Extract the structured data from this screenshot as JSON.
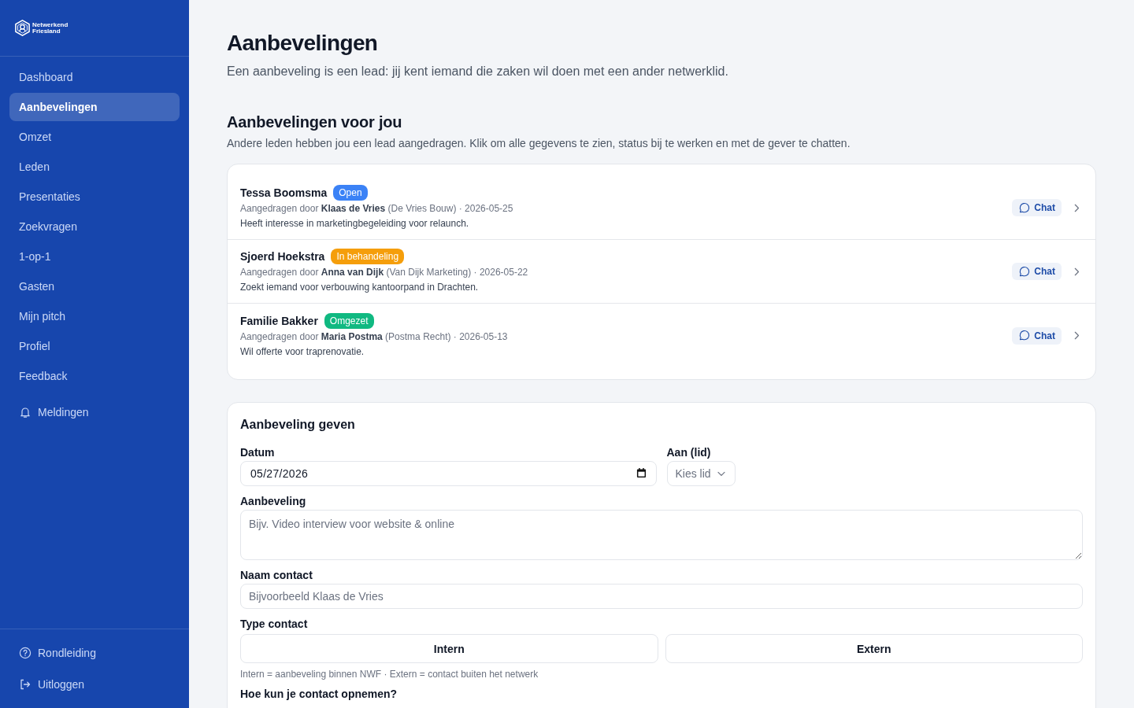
{
  "sidebar": {
    "brand": [
      "Netwerkend",
      "Friesland"
    ],
    "nav": [
      {
        "label": "Dashboard",
        "selected": false
      },
      {
        "label": "Aanbevelingen",
        "selected": true
      },
      {
        "label": "Omzet",
        "selected": false
      },
      {
        "label": "Leden",
        "selected": false
      },
      {
        "label": "Presentaties",
        "selected": false
      },
      {
        "label": "Zoekvragen",
        "selected": false
      },
      {
        "label": "1-op-1",
        "selected": false
      },
      {
        "label": "Gasten",
        "selected": false
      },
      {
        "label": "Mijn pitch",
        "selected": false
      },
      {
        "label": "Profiel",
        "selected": false
      },
      {
        "label": "Feedback",
        "selected": false
      }
    ],
    "notifications": {
      "label": "Meldingen",
      "selected": false
    },
    "footer": [
      {
        "label": "Rondleiding"
      },
      {
        "label": "Uitloggen"
      }
    ]
  },
  "page": {
    "title": "Aanbevelingen",
    "subtitle": "Een aanbeveling is een lead: jij kent iemand die zaken wil doen met een ander netwerklid."
  },
  "received": {
    "title": "Aanbevelingen voor jou",
    "description": "Andere leden hebben jou een lead aangedragen. Klik om alle gegevens te zien, status bij te werken en met de gever te chatten.",
    "items": [
      {
        "name": "Tessa Boomsma",
        "status": "Open",
        "color": "#3b82f6",
        "by": "Aangedragen door **Klaas de Vries** (De Vries Bouw) · 2026-05-25",
        "note": "Heeft interesse in marketingbegeleiding voor relaunch.",
        "chat": "Chat"
      },
      {
        "name": "Sjoerd Hoekstra",
        "status": "In behandeling",
        "color": "#f59e0b",
        "by": "Aangedragen door **Anna van Dijk** (Van Dijk Marketing) · 2026-05-22",
        "note": "Zoekt iemand voor verbouwing kantoorpand in Drachten.",
        "chat": "Chat"
      },
      {
        "name": "Familie Bakker",
        "status": "Omgezet",
        "color": "#10b981",
        "by": "Aangedragen door **Maria Postma** (Postma Recht) · 2026-05-13",
        "note": "Wil offerte voor traprenovatie.",
        "chat": "Chat"
      }
    ]
  },
  "form": {
    "title": "Aanbeveling geven",
    "date": {
      "label": "Datum",
      "value": "05/27/2026"
    },
    "member": {
      "label": "Aan (lid)",
      "placeholder": "Kies lid"
    },
    "recommendation": {
      "label": "Aanbeveling",
      "placeholder": "Bijv. Video interview voor website & online"
    },
    "contact_name": {
      "label": "Naam contact",
      "placeholder": "Bijvoorbeeld Klaas de Vries"
    },
    "contact_type": {
      "label": "Type contact",
      "options": [
        {
          "label": "Intern",
          "selected": false
        },
        {
          "label": "Extern",
          "selected": false
        }
      ],
      "hint": "Intern = aanbeveling binnen NWF · Extern = contact buiten het netwerk"
    },
    "contact_method": {
      "label": "Hoe kun je contact opnemen?"
    }
  }
}
